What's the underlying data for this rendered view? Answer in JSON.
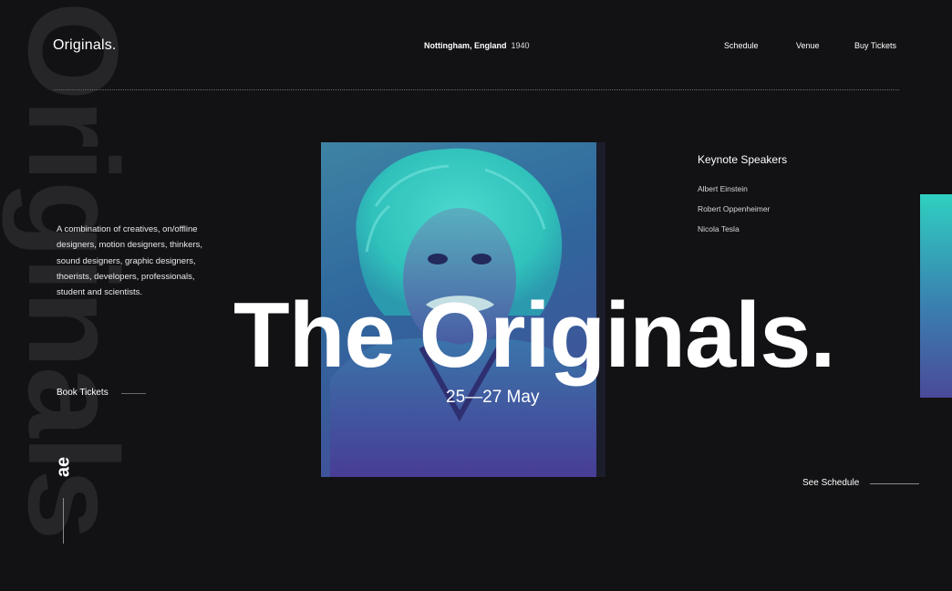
{
  "header": {
    "logo": "Originals.",
    "location_city": "Nottingham, England",
    "location_year": "1940",
    "nav": [
      "Schedule",
      "Venue",
      "Buy Tickets"
    ]
  },
  "watermark": "Originals",
  "intro": {
    "description": "A combination of creatives, on/offline designers, motion designers, thinkers, sound designers, graphic designers, thoerists, developers, professionals, student and scientists.",
    "book_label": "Book Tickets"
  },
  "brand_mark": "ae",
  "keynote": {
    "title": "Keynote Speakers",
    "speakers": [
      "Albert Einstein",
      "Robert Oppenheimer",
      "Nicola Tesla"
    ]
  },
  "hero": {
    "title": "The Originals.",
    "dates": "25—27 May"
  },
  "schedule_link": "See Schedule",
  "colors": {
    "background": "#121113",
    "accent_teal": "#2fd6c2",
    "accent_violet": "#4b3f9a"
  }
}
